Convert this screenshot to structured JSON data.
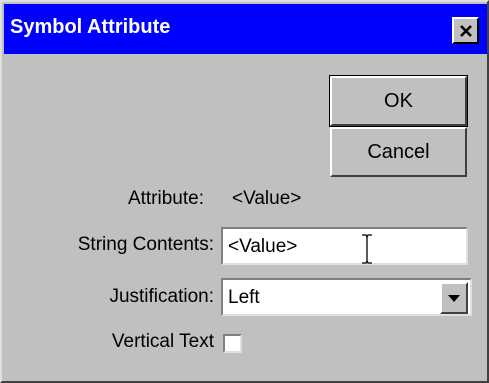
{
  "window": {
    "title": "Symbol Attribute",
    "close_icon": "close-icon"
  },
  "buttons": {
    "ok_label": "OK",
    "cancel_label": "Cancel"
  },
  "form": {
    "attribute_label": "Attribute:",
    "attribute_value": "<Value>",
    "string_contents_label": "String Contents:",
    "string_contents_value": "<Value>",
    "justification_label": "Justification:",
    "justification_value": "Left",
    "vertical_text_label": "Vertical Text",
    "vertical_text_checked": false
  },
  "colors": {
    "titlebar": "#0000ff",
    "dialog_bg": "#c0c0c0",
    "title_text": "#ffffff"
  }
}
